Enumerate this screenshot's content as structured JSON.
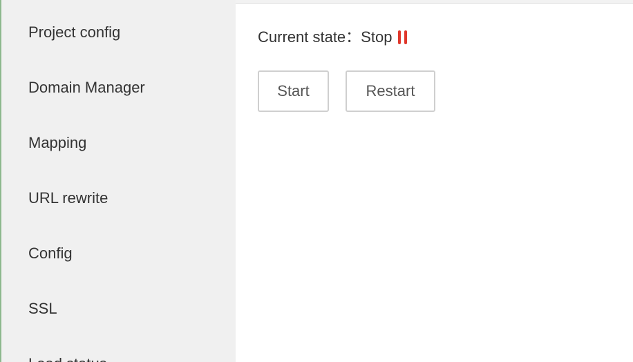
{
  "sidebar": {
    "items": [
      {
        "label": "Project config"
      },
      {
        "label": "Domain Manager"
      },
      {
        "label": "Mapping"
      },
      {
        "label": "URL rewrite"
      },
      {
        "label": "Config"
      },
      {
        "label": "SSL"
      },
      {
        "label": "Load status"
      }
    ]
  },
  "main": {
    "state_label": "Current state：",
    "state_value": "Stop",
    "state_icon": "pause-icon",
    "state_color": "#e0372b",
    "buttons": {
      "start_label": "Start",
      "restart_label": "Restart"
    }
  }
}
